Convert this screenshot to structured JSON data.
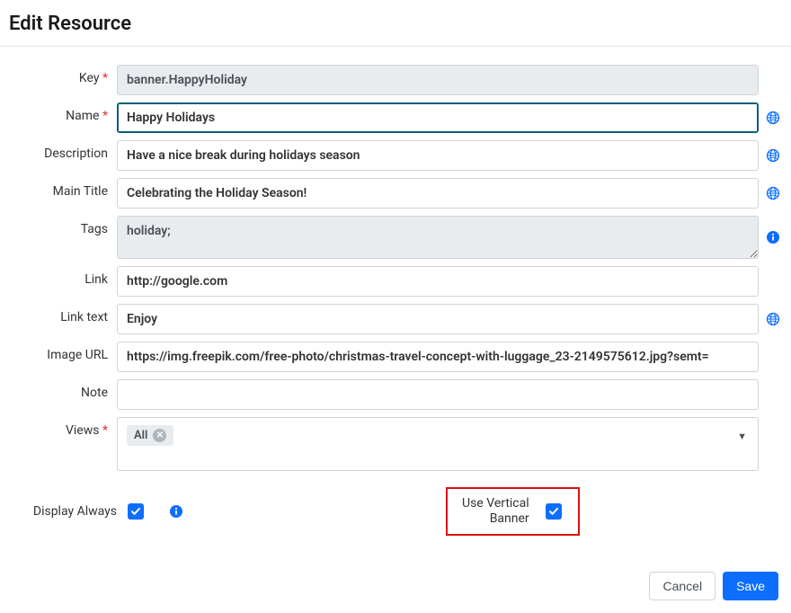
{
  "page_title": "Edit Resource",
  "labels": {
    "key": "Key",
    "name": "Name",
    "description": "Description",
    "main_title": "Main Title",
    "tags": "Tags",
    "link": "Link",
    "link_text": "Link text",
    "image_url": "Image URL",
    "note": "Note",
    "views": "Views",
    "display_always": "Display Always",
    "use_vertical_banner_line1": "Use Vertical",
    "use_vertical_banner_line2": "Banner"
  },
  "values": {
    "key": "banner.HappyHoliday",
    "name": "Happy Holidays",
    "description": "Have a nice break during holidays season",
    "main_title": "Celebrating the Holiday Season!",
    "tags": "holiday;",
    "link": "http://google.com",
    "link_text": "Enjoy",
    "image_url": "https://img.freepik.com/free-photo/christmas-travel-concept-with-luggage_23-2149575612.jpg?semt=",
    "note": ""
  },
  "views_chip": "All",
  "display_always_checked": true,
  "use_vertical_banner_checked": true,
  "buttons": {
    "cancel": "Cancel",
    "save": "Save"
  },
  "icons": {
    "globe_color": "#0d6efd",
    "info_color": "#0d6efd"
  }
}
